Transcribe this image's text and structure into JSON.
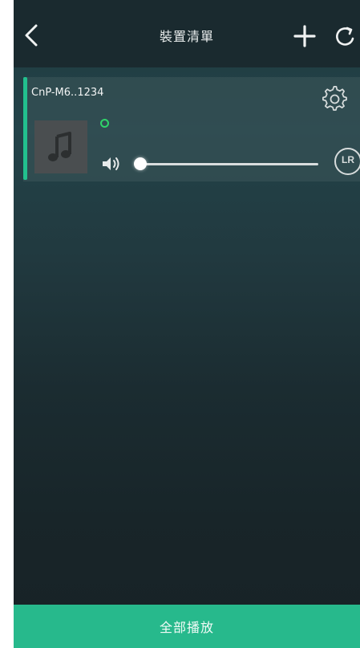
{
  "header": {
    "title": "裝置清單",
    "back_icon": "chevron-left-icon",
    "add_icon": "plus-icon",
    "refresh_icon": "refresh-icon"
  },
  "devices": [
    {
      "name": "CnP-M6..1234",
      "status": "online",
      "status_color": "#2fd46a",
      "album_icon": "music-note-icon",
      "volume_icon": "speaker-icon",
      "volume_level": 0.0,
      "channel_label": "LR",
      "settings_icon": "gear-icon",
      "accent_color": "#22c08e"
    }
  ],
  "footer": {
    "play_all_label": "全部播放",
    "color": "#27b98c"
  }
}
